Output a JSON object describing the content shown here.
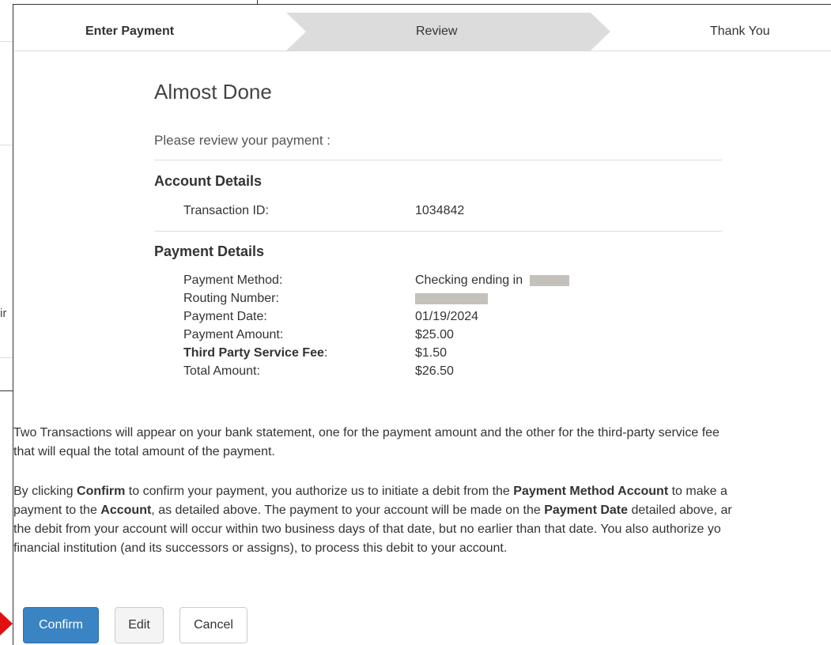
{
  "background": {
    "fragment": "ir"
  },
  "steps": [
    {
      "label": "Enter Payment"
    },
    {
      "label": "Review"
    },
    {
      "label": "Thank You"
    }
  ],
  "heading": {
    "title": "Almost Done",
    "subtitle": "Please review your payment :"
  },
  "account_details": {
    "title": "Account Details",
    "rows": [
      {
        "label": "Transaction ID:",
        "value": "1034842"
      }
    ]
  },
  "payment_details": {
    "title": "Payment Details",
    "rows": [
      {
        "label": "Payment Method:",
        "value": "Checking ending in",
        "redacted": true
      },
      {
        "label": "Routing Number:",
        "value": "",
        "redacted": true
      },
      {
        "label": "Payment Date:",
        "value": "01/19/2024"
      },
      {
        "label": "Payment Amount:",
        "value": "$25.00"
      },
      {
        "label": "Third Party Service Fee",
        "label_suffix": ":",
        "value": "$1.50",
        "bold": true
      },
      {
        "label": "Total Amount:",
        "value": "$26.50"
      }
    ]
  },
  "notice": {
    "line1": "Two Transactions will appear on your bank statement, one for the payment amount and the other for the third-party service fee",
    "line2": "that will equal the total amount of the payment."
  },
  "authorization": {
    "l1_a": "By clicking ",
    "l1_b": "Confirm",
    "l1_c": " to confirm your payment, you authorize us to initiate a debit from the ",
    "l1_d": "Payment Method Account",
    "l1_e": " to make a",
    "l2_a": "payment to the ",
    "l2_b": "Account",
    "l2_c": ", as detailed above. The payment to your account will be made on the ",
    "l2_d": "Payment Date",
    "l2_e": " detailed above, ar",
    "l3": "the debit from your account will occur within two business days of that date, but no earlier than that date. You also authorize yo",
    "l4": "financial institution (and its successors or assigns), to process this debit to your account."
  },
  "buttons": {
    "confirm": "Confirm",
    "edit": "Edit",
    "cancel": "Cancel"
  },
  "colors": {
    "primary": "#3b84c4",
    "step_active_bg": "#dcdcdc",
    "redaction": "#c4c0bb",
    "arrow": "#e01010"
  }
}
